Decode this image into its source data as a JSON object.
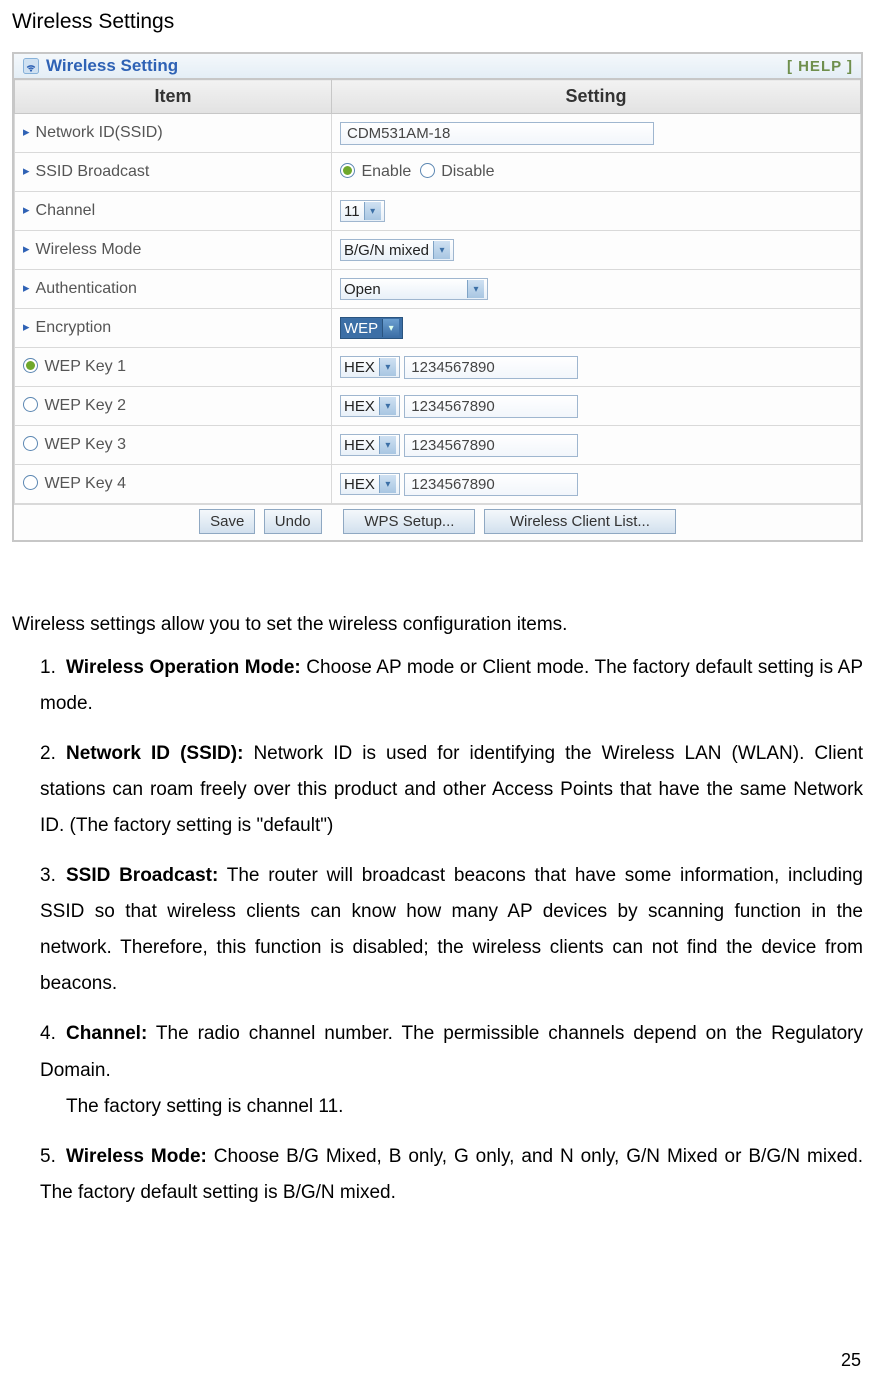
{
  "section_title": "Wireless Settings",
  "panel": {
    "title": "Wireless Setting",
    "help": "[ HELP ]"
  },
  "th": {
    "item": "Item",
    "setting": "Setting"
  },
  "rows": {
    "ssid": {
      "label": "Network ID(SSID)",
      "value": "CDM531AM-18"
    },
    "broadcast": {
      "label": "SSID Broadcast",
      "enable": "Enable",
      "disable": "Disable"
    },
    "channel": {
      "label": "Channel",
      "value": "11"
    },
    "mode": {
      "label": "Wireless Mode",
      "value": "B/G/N mixed"
    },
    "auth": {
      "label": "Authentication",
      "value": "Open"
    },
    "enc": {
      "label": "Encryption",
      "value": "WEP"
    },
    "keys": [
      {
        "label": "WEP Key 1",
        "format": "HEX",
        "value": "1234567890",
        "selected": true
      },
      {
        "label": "WEP Key 2",
        "format": "HEX",
        "value": "1234567890",
        "selected": false
      },
      {
        "label": "WEP Key 3",
        "format": "HEX",
        "value": "1234567890",
        "selected": false
      },
      {
        "label": "WEP Key 4",
        "format": "HEX",
        "value": "1234567890",
        "selected": false
      }
    ]
  },
  "buttons": {
    "save": "Save",
    "undo": "Undo",
    "wps": "WPS Setup...",
    "clients": "Wireless Client List..."
  },
  "intro": "Wireless settings allow you to set the wireless configuration items.",
  "items": [
    {
      "n": "1.",
      "b": "Wireless Operation Mode:",
      "t": " Choose AP mode or Client mode. The factory default setting is AP mode."
    },
    {
      "n": "2.",
      "b": "Network ID (SSID):",
      "t": " Network ID is used for identifying the Wireless LAN (WLAN). Client stations can roam freely over this product and other Access Points that have the same Network ID. (The factory setting is \"default\")"
    },
    {
      "n": "3.",
      "b": "SSID Broadcast:",
      "t": " The router will broadcast beacons that have some information, including SSID so that wireless clients can know how many AP devices by scanning function in the network. Therefore, this function is disabled; the wireless clients can not find the device from beacons."
    },
    {
      "n": "4.",
      "b": "Channel:",
      "t": " The radio channel number. The permissible channels depend on the Regulatory Domain.",
      "extra": "The factory setting is channel 11."
    },
    {
      "n": "5.",
      "b": "Wireless Mode:",
      "t": " Choose B/G Mixed, B only, G only, and N only, G/N Mixed or B/G/N mixed. The factory default setting is B/G/N mixed."
    }
  ],
  "page_number": "25"
}
